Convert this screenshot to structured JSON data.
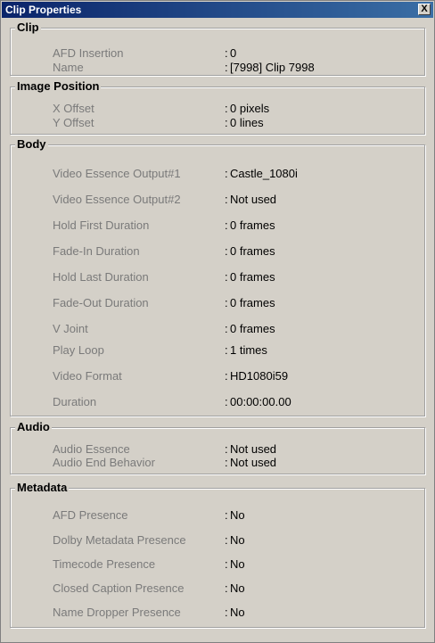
{
  "window": {
    "title": "Clip Properties",
    "close_label": "X"
  },
  "clip": {
    "title": "Clip",
    "rows": [
      {
        "label": "AFD Insertion",
        "value": "0"
      },
      {
        "label": "Name",
        "value": "[7998] Clip 7998"
      }
    ]
  },
  "image_position": {
    "title": "Image Position",
    "rows": [
      {
        "label": "X Offset",
        "value": "0 pixels"
      },
      {
        "label": "Y Offset",
        "value": "0 lines"
      }
    ]
  },
  "body": {
    "title": "Body",
    "rows": [
      {
        "label": "Video Essence Output#1",
        "value": "Castle_1080i"
      },
      {
        "label": "Video Essence Output#2",
        "value": "Not used"
      },
      {
        "label": "Hold First Duration",
        "value": "0 frames"
      },
      {
        "label": "Fade-In Duration",
        "value": "0 frames"
      },
      {
        "label": "Hold Last Duration",
        "value": "0 frames"
      },
      {
        "label": "Fade-Out Duration",
        "value": "0 frames"
      },
      {
        "label": "V Joint",
        "value": "0 frames"
      },
      {
        "label": "Play Loop",
        "value": "1 times"
      },
      {
        "label": "Video Format",
        "value": "HD1080i59"
      },
      {
        "label": "Duration",
        "value": "00:00:00.00"
      }
    ]
  },
  "audio": {
    "title": "Audio",
    "rows": [
      {
        "label": "Audio Essence",
        "value": "Not used"
      },
      {
        "label": "Audio End Behavior",
        "value": "Not used"
      }
    ]
  },
  "metadata": {
    "title": "Metadata",
    "rows": [
      {
        "label": "AFD Presence",
        "value": "No"
      },
      {
        "label": "Dolby Metadata Presence",
        "value": "No"
      },
      {
        "label": "Timecode Presence",
        "value": "No"
      },
      {
        "label": "Closed Caption Presence",
        "value": "No"
      },
      {
        "label": "Name Dropper Presence",
        "value": "No"
      }
    ]
  }
}
